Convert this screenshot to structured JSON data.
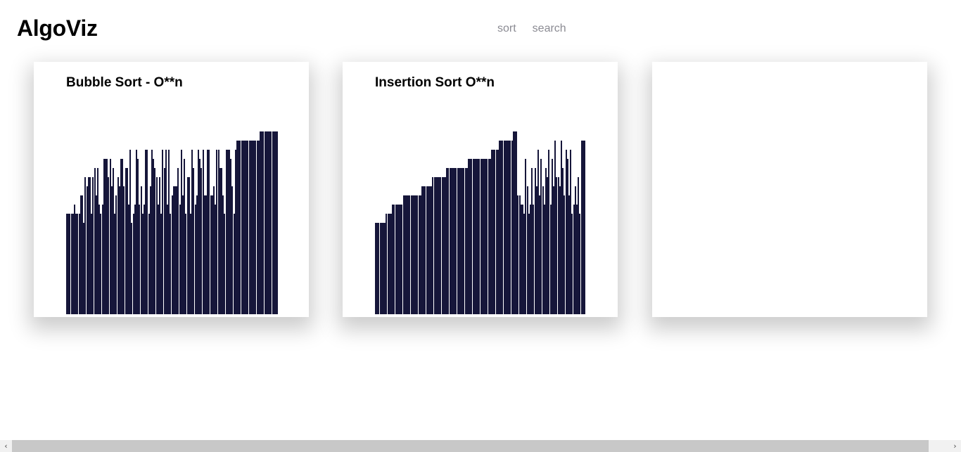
{
  "app": {
    "title": "AlgoViz",
    "nav": [
      {
        "label": "sort"
      },
      {
        "label": "search"
      }
    ]
  },
  "cards": [
    {
      "title": "Bubble Sort - O**n",
      "bar_color": "#16163a",
      "max_value": 20,
      "values": [
        11,
        11,
        11,
        11,
        11,
        12,
        11,
        11,
        11,
        13,
        13,
        10,
        15,
        14,
        15,
        15,
        11,
        15,
        16,
        13,
        16,
        12,
        11,
        12,
        17,
        17,
        17,
        15,
        17,
        14,
        16,
        11,
        13,
        15,
        14,
        17,
        17,
        14,
        16,
        16,
        12,
        18,
        10,
        11,
        12,
        18,
        17,
        12,
        14,
        11,
        12,
        18,
        18,
        11,
        14,
        18,
        17,
        16,
        15,
        12,
        15,
        11,
        18,
        16,
        18,
        12,
        18,
        11,
        13,
        14,
        14,
        14,
        16,
        12,
        18,
        13,
        17,
        11,
        15,
        15,
        11,
        18,
        16,
        12,
        13,
        18,
        17,
        16,
        18,
        13,
        13,
        18,
        18,
        13,
        13,
        14,
        12,
        18,
        18,
        16,
        16,
        13,
        11,
        18,
        18,
        18,
        17,
        14,
        11,
        18,
        19,
        19,
        19,
        19,
        19,
        19,
        19,
        19,
        19,
        19,
        19,
        19,
        19,
        19,
        19,
        20,
        20,
        20,
        20,
        20,
        20,
        20,
        20,
        20,
        20,
        20,
        20
      ]
    },
    {
      "title": "Insertion Sort O**n",
      "bar_color": "#16163a",
      "max_value": 20,
      "values": [
        10,
        10,
        10,
        10,
        10,
        10,
        10,
        11,
        11,
        11,
        11,
        12,
        12,
        12,
        12,
        12,
        12,
        12,
        13,
        13,
        13,
        13,
        13,
        13,
        13,
        13,
        13,
        13,
        13,
        13,
        14,
        14,
        14,
        14,
        14,
        14,
        14,
        15,
        15,
        15,
        15,
        15,
        15,
        15,
        15,
        15,
        16,
        16,
        16,
        16,
        16,
        16,
        16,
        16,
        16,
        16,
        16,
        16,
        16,
        16,
        17,
        17,
        17,
        17,
        17,
        17,
        17,
        17,
        17,
        17,
        17,
        17,
        17,
        17,
        17,
        18,
        18,
        18,
        18,
        18,
        19,
        19,
        19,
        19,
        19,
        19,
        19,
        19,
        19,
        20,
        20,
        20,
        13,
        13,
        12,
        12,
        11,
        17,
        14,
        11,
        12,
        16,
        12,
        16,
        14,
        18,
        13,
        17,
        14,
        12,
        16,
        15,
        18,
        12,
        17,
        14,
        19,
        15,
        15,
        14,
        19,
        16,
        13,
        18,
        17,
        13,
        18,
        11,
        12,
        14,
        12,
        15,
        11,
        19,
        19,
        19
      ]
    },
    {
      "title": "",
      "values": []
    }
  ],
  "scrollbar": {
    "left_arrow": "‹",
    "right_arrow": "›"
  }
}
